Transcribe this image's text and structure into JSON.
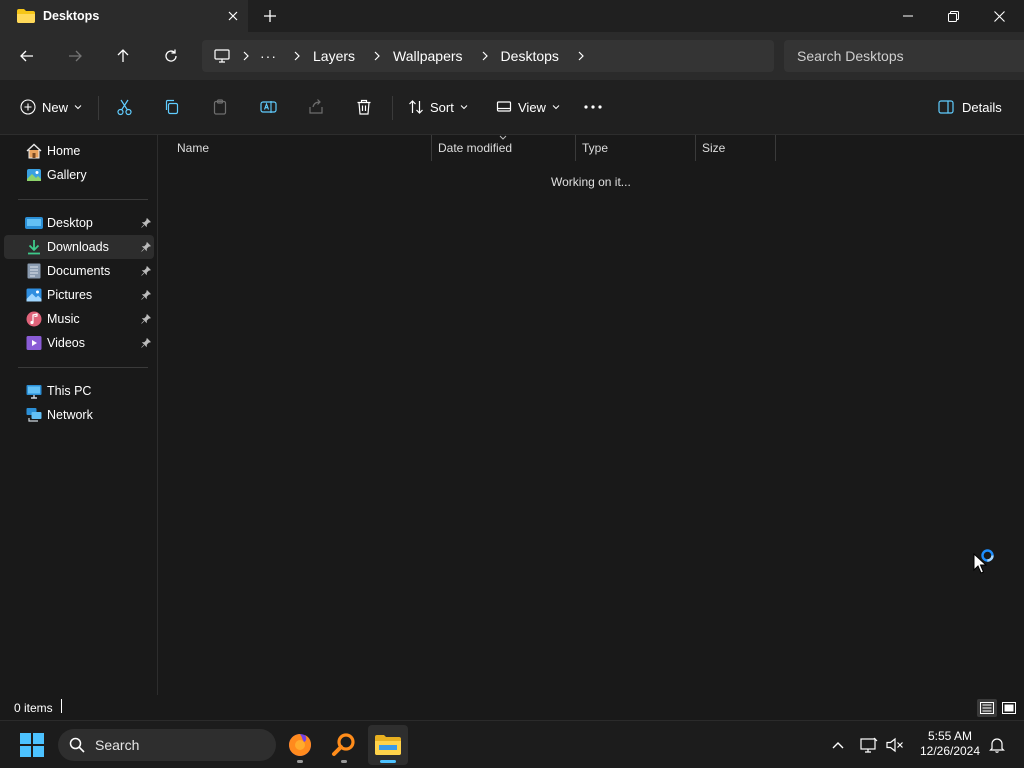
{
  "window": {
    "tab_title": "Desktops",
    "tab_close_icon": "close-icon",
    "new_tab_icon": "plus-icon",
    "controls": [
      "minimize-icon",
      "restore-icon",
      "close-icon"
    ]
  },
  "address": {
    "crumbs": [
      "Layers",
      "Wallpapers",
      "Desktops"
    ],
    "overflow": "···",
    "search_placeholder": "Search Desktops"
  },
  "commands": {
    "new_label": "New",
    "sort_label": "Sort",
    "view_label": "View",
    "details_label": "Details"
  },
  "sidebar": {
    "quick": [
      {
        "label": "Home",
        "icon": "home-icon"
      },
      {
        "label": "Gallery",
        "icon": "gallery-icon"
      }
    ],
    "pinned": [
      {
        "label": "Desktop",
        "icon": "desktop-folder-icon"
      },
      {
        "label": "Downloads",
        "icon": "downloads-folder-icon",
        "selected": true
      },
      {
        "label": "Documents",
        "icon": "documents-folder-icon"
      },
      {
        "label": "Pictures",
        "icon": "pictures-folder-icon"
      },
      {
        "label": "Music",
        "icon": "music-folder-icon"
      },
      {
        "label": "Videos",
        "icon": "videos-folder-icon"
      }
    ],
    "devices": [
      {
        "label": "This PC",
        "icon": "this-pc-icon"
      },
      {
        "label": "Network",
        "icon": "network-icon"
      }
    ]
  },
  "content": {
    "columns": [
      "Name",
      "Date modified",
      "Type",
      "Size"
    ],
    "status_message": "Working on it..."
  },
  "status": {
    "item_count": "0 items"
  },
  "taskbar": {
    "search_label": "Search",
    "time": "5:55 AM",
    "date": "12/26/2024"
  },
  "colors": {
    "accent": "#4cc2ff",
    "folder_yellow": "#f5c518"
  }
}
